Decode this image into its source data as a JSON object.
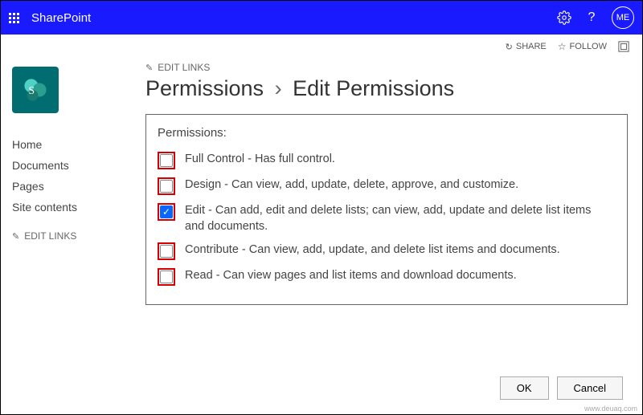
{
  "topbar": {
    "brand": "SharePoint",
    "avatar_initials": "ME"
  },
  "actions": {
    "share": "SHARE",
    "follow": "FOLLOW"
  },
  "sidebar": {
    "items": [
      "Home",
      "Documents",
      "Pages",
      "Site contents"
    ],
    "edit_links": "EDIT LINKS"
  },
  "main": {
    "edit_links": "EDIT LINKS",
    "breadcrumb_root": "Permissions",
    "breadcrumb_sep": "›",
    "breadcrumb_current": "Edit Permissions"
  },
  "panel": {
    "title": "Permissions:",
    "items": [
      {
        "label": "Full Control - Has full control.",
        "checked": false
      },
      {
        "label": "Design - Can view, add, update, delete, approve, and customize.",
        "checked": false
      },
      {
        "label": "Edit - Can add, edit and delete lists; can view, add, update and delete list items and documents.",
        "checked": true
      },
      {
        "label": "Contribute - Can view, add, update, and delete list items and documents.",
        "checked": false
      },
      {
        "label": "Read - Can view pages and list items and download documents.",
        "checked": false
      }
    ]
  },
  "footer": {
    "ok": "OK",
    "cancel": "Cancel"
  },
  "watermark": "www.deuaq.com"
}
